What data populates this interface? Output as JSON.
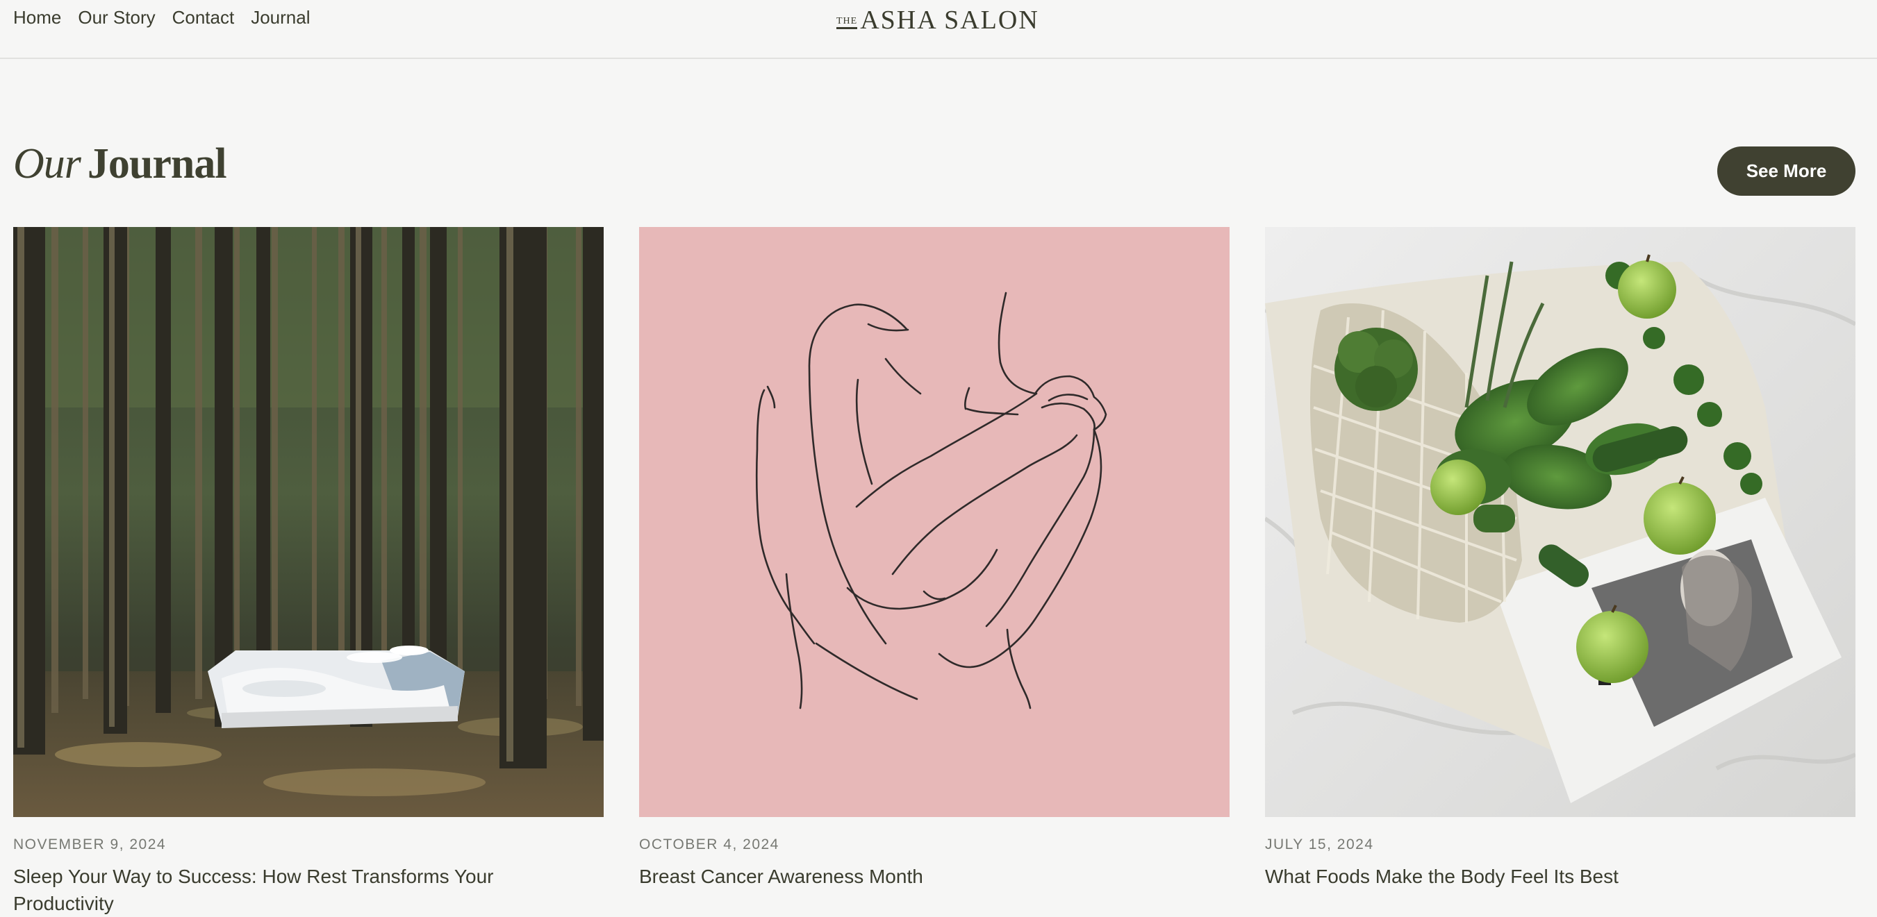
{
  "nav": {
    "items": [
      "Home",
      "Our Story",
      "Contact",
      "Journal"
    ]
  },
  "logo": {
    "prefix": "THE",
    "name": "ASHA SALON"
  },
  "section": {
    "title_italic": "Our",
    "title_rest": "Journal",
    "see_more_label": "See More"
  },
  "posts": [
    {
      "date": "NOVEMBER 9, 2024",
      "title": "Sleep Your Way to Success: How Rest Transforms Your Productivity",
      "image": "forest-bed-photo"
    },
    {
      "date": "OCTOBER 4, 2024",
      "title": "Breast Cancer Awareness Month",
      "image": "line-art-figure-illustration"
    },
    {
      "date": "JULY 15, 2024",
      "title": "What Foods Make the Body Feel Its Best",
      "image": "green-groceries-photo"
    }
  ],
  "colors": {
    "background": "#f6f6f5",
    "text": "#3f4131",
    "button": "#404131",
    "pink_panel": "#e7b8b8"
  }
}
